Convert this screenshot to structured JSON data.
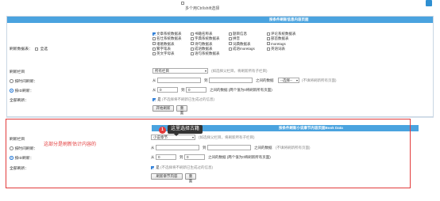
{
  "top": {
    "hint": "多个用Ctrl/shift选择",
    "first_checkbox_label": ""
  },
  "panel1": {
    "header": "按条件刷新信息内容页面",
    "refresh_data_label": "刷新数据表：",
    "all_label": "全选",
    "tables": [
      {
        "label": "文章系统数据表",
        "checked": true
      },
      {
        "label": "书籍名称表",
        "checked": false
      },
      {
        "label": "题目信息",
        "checked": false
      },
      {
        "label": "评论系统数据表",
        "checked": false
      },
      {
        "label": "名仕系统数据表",
        "checked": false
      },
      {
        "label": "字典系统数据表",
        "checked": false
      },
      {
        "label": "拼音",
        "checked": false
      },
      {
        "label": "部首数据表",
        "checked": false
      },
      {
        "label": "诸葛数据表",
        "checked": false
      },
      {
        "label": "诗句数据表",
        "checked": false
      },
      {
        "label": "词典数据表",
        "checked": false
      },
      {
        "label": "moretags",
        "checked": false
      },
      {
        "label": "繁字笔表",
        "checked": false
      },
      {
        "label": "成语数据表",
        "checked": false
      },
      {
        "label": "成语moretags",
        "checked": false
      },
      {
        "label": "英语词表",
        "checked": false
      },
      {
        "label": "英文字母表",
        "checked": false
      },
      {
        "label": "语句系统数据表",
        "checked": false
      }
    ],
    "refresh_column_label": "刷新栏目",
    "column_select": "所有栏目",
    "column_hint": "(如选择父栏目，将刷新所有子栏目)",
    "by_time_label": "按时间刷新：",
    "from_label": "从",
    "to_label": "到",
    "between_data": "之间的数据",
    "period_select": "--选择--",
    "period_hint": "(不填将刷新所有页面)",
    "by_id_label": "按ID刷新：",
    "id_from_label": "从",
    "id_from_value": "0",
    "id_to_label": "到",
    "id_to_value": "0",
    "id_hint": "之间的数据 (两个值为0将刷新所有页面)",
    "full_refresh_label": "全部刷新：",
    "full_refresh_value": "是",
    "full_refresh_hint": "(不选择将不刷新已生成过的信息)",
    "start_button": "开始刷新",
    "reset_button": "重置"
  },
  "panel2": {
    "header": "按条件刷新小说章节内容页面Book Data",
    "refresh_column_label": "刷新栏目",
    "column_select": "小说章节",
    "column_hint": "(如选择父栏目，将刷新所有子栏目)",
    "by_time_label": "按时间刷新：",
    "from_label": "从",
    "to_label": "到",
    "between_data": "之间的数据",
    "period_hint": "(不填将刷新所有页面)",
    "by_id_label": "按ID刷新：",
    "id_from_label": "从",
    "id_from_value": "0",
    "id_to_label": "到",
    "id_to_value": "0",
    "id_hint": "之间的数据 (两个值为0将刷新所有页面)",
    "full_refresh_label": "全部刷新：",
    "full_refresh_value": "是",
    "full_refresh_hint": "(不选择将不刷新已生成过的信息)",
    "start_button": "刷新章节内容",
    "reset_button": "重置"
  },
  "annotation": {
    "badge": "1",
    "tooltip": "这里选择古籍",
    "note": "这部分是刷新估计内容的"
  },
  "colors": {
    "header_blue": "#4aa3df",
    "annotation_red": "#e23b3b",
    "checkbox_blue": "#2f7fd8"
  }
}
